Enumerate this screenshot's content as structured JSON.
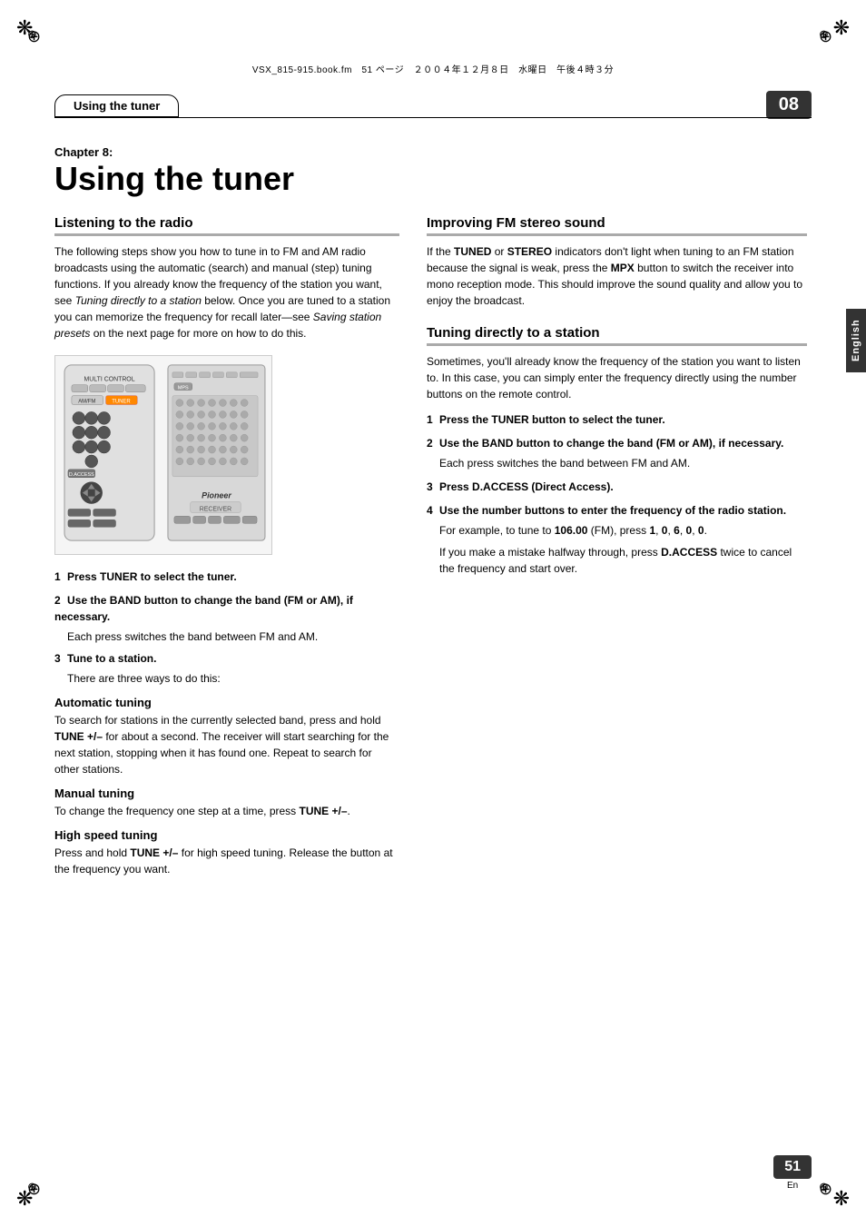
{
  "file_info": "VSX_815-915.book.fm　51 ページ　２００４年１２月８日　水曜日　午後４時３分",
  "header": {
    "title": "Using the tuner",
    "chapter_num": "08"
  },
  "chapter": {
    "label": "Chapter 8:",
    "title": "Using the tuner"
  },
  "english_label": "English",
  "left_col": {
    "section_heading": "Listening to the radio",
    "intro": "The following steps show you how to tune in to FM and AM radio broadcasts using the automatic (search) and manual (step) tuning functions. If you already know the frequency of the station you want, see Tuning directly to a station below. Once you are tuned to a station you can memorize the frequency for recall later—see Saving station presets on the next page for more on how to do this.",
    "steps": [
      {
        "num": "1",
        "text": "Press TUNER to select the tuner."
      },
      {
        "num": "2",
        "text": "Use the BAND button to change the band (FM or AM), if necessary.",
        "detail": "Each press switches the band between FM and AM."
      },
      {
        "num": "3",
        "text": "Tune to a station.",
        "detail": "There are three ways to do this:"
      }
    ],
    "automatic_heading": "Automatic tuning",
    "automatic_text": "To search for stations in the currently selected band, press and hold TUNE +/– for about a second. The receiver will start searching for the next station, stopping when it has found one. Repeat to search for other stations.",
    "manual_heading": "Manual tuning",
    "manual_text": "To change the frequency one step at a time, press TUNE +/–.",
    "high_speed_heading": "High speed tuning",
    "high_speed_text": "Press and hold TUNE +/– for high speed tuning. Release the button at the frequency you want."
  },
  "right_col": {
    "improving_heading": "Improving FM stereo sound",
    "improving_text": "If the TUNED or STEREO indicators don't light when tuning to an FM station because the signal is weak, press the MPX button to switch the receiver into mono reception mode. This should improve the sound quality and allow you to enjoy the broadcast.",
    "tuning_heading": "Tuning directly to a station",
    "tuning_intro": "Sometimes, you'll already know the frequency of the station you want to listen to. In this case, you can simply enter the frequency directly using the number buttons on the remote control.",
    "steps": [
      {
        "num": "1",
        "text": "Press the TUNER button to select the tuner."
      },
      {
        "num": "2",
        "text": "Use the BAND button to change the band (FM or AM), if necessary.",
        "detail": "Each press switches the band between FM and AM."
      },
      {
        "num": "3",
        "text": "Press D.ACCESS (Direct Access)."
      },
      {
        "num": "4",
        "text": "Use the number buttons to enter the frequency of the radio station.",
        "detail": "For example, to tune to 106.00 (FM), press 1, 0, 6, 0, 0.",
        "detail2": "If you make a mistake halfway through, press D.ACCESS twice to cancel the frequency and start over."
      }
    ]
  },
  "page": {
    "number": "51",
    "lang": "En"
  }
}
